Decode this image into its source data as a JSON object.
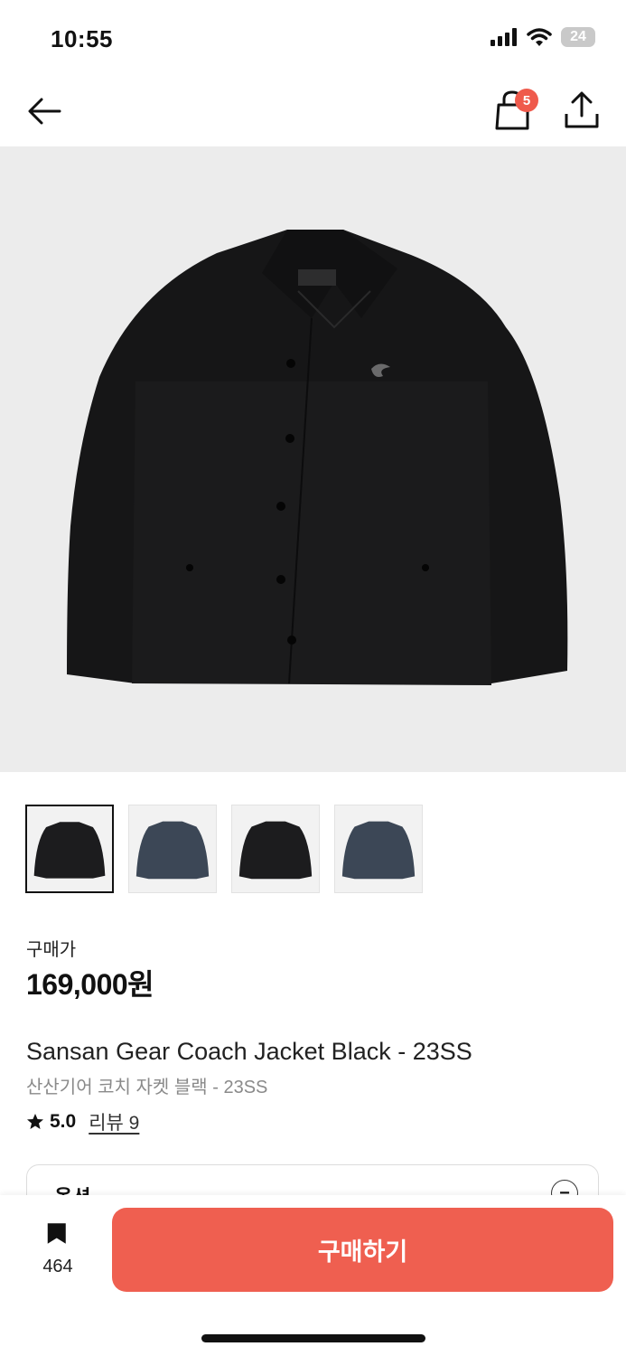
{
  "status_bar": {
    "time": "10:55",
    "battery": "24"
  },
  "header": {
    "cart_count": "5",
    "icons": [
      "back-arrow-icon",
      "shopping-bag-icon",
      "share-icon"
    ]
  },
  "gallery": {
    "thumbnails": [
      {
        "color_name": "black",
        "color": "#1c1c1e",
        "selected": true
      },
      {
        "color_name": "navy",
        "color": "#3c4756",
        "selected": false
      },
      {
        "color_name": "black",
        "color": "#1c1c1e",
        "selected": false
      },
      {
        "color_name": "navy",
        "color": "#3c4756",
        "selected": false
      }
    ]
  },
  "product": {
    "price_label": "구매가",
    "price": "169,000원",
    "name_en": "Sansan Gear Coach Jacket Black - 23SS",
    "name_ko": "산산기어 코치 자켓 블랙 - 23SS",
    "rating": "5.0",
    "review_label": "리뷰 9"
  },
  "options": {
    "label": "옵션",
    "toggle": "−"
  },
  "bottom_bar": {
    "bookmark_count": "464",
    "buy_label": "구매하기"
  },
  "colors": {
    "accent": "#ef5f50",
    "badge": "#ef5a4c",
    "hero_bg": "#ececec"
  }
}
